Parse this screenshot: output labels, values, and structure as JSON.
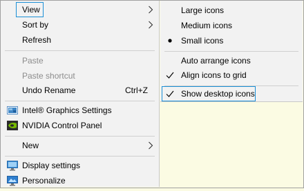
{
  "context_menu": {
    "items": [
      {
        "label": "View"
      },
      {
        "label": "Sort by"
      },
      {
        "label": "Refresh"
      },
      {
        "label": "Paste"
      },
      {
        "label": "Paste shortcut"
      },
      {
        "label": "Undo Rename",
        "shortcut": "Ctrl+Z"
      },
      {
        "label": "Intel® Graphics Settings"
      },
      {
        "label": "NVIDIA Control Panel"
      },
      {
        "label": "New"
      },
      {
        "label": "Display settings"
      },
      {
        "label": "Personalize"
      }
    ]
  },
  "view_submenu": {
    "items": [
      {
        "label": "Large icons"
      },
      {
        "label": "Medium icons"
      },
      {
        "label": "Small icons"
      },
      {
        "label": "Auto arrange icons"
      },
      {
        "label": "Align icons to grid"
      },
      {
        "label": "Show desktop icons"
      }
    ]
  },
  "colors": {
    "menu_background": "#f2f2f2",
    "highlight_border": "#1a8fd6",
    "desktop_background": "#fbfbe3"
  },
  "icons": [
    "chevron-right-icon",
    "intel-graphics-icon",
    "nvidia-icon",
    "display-settings-icon",
    "personalize-icon",
    "bullet-icon",
    "checkmark-icon"
  ]
}
